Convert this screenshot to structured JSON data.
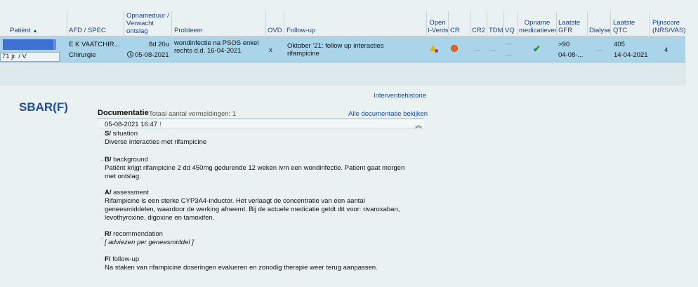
{
  "table": {
    "headers": {
      "patient": "Patiënt",
      "afd": "AFD / SPEC",
      "opname": [
        "Opnameduur /",
        "Verwacht",
        "ontslag"
      ],
      "probleem": "Probleem",
      "ovd": "OVD",
      "followup": "Follow-up",
      "open": [
        "Open",
        "I-Vents"
      ],
      "cr": "CR",
      "cr2": "CR2",
      "tdm": "TDM",
      "vq": "VQ",
      "opname_med": [
        "Opname",
        "medicatiever"
      ],
      "gfr": [
        "Laatste",
        "GFR"
      ],
      "dialyse": "Dialyse",
      "qtc": [
        "Laatste",
        "QTC"
      ],
      "pijn": [
        "Pijnscore",
        "(NRS/VAS)"
      ]
    },
    "row": {
      "age": "71 jr. / V",
      "afd": "E K VAATCHIR...",
      "spec": "Chirurgie",
      "duur": "8d 20u",
      "datum": "05-08-2021",
      "probleem": [
        "wondinfectie na PSOS enkel",
        "rechts d.d. 16-04-2021"
      ],
      "ovd": "x",
      "followup": [
        "Oktober '21: follow up interacties",
        "rifampicine"
      ],
      "dash": "—",
      "gfr": ">90",
      "gfr_date": "04-08-...",
      "qtc": "405",
      "qtc_date": "14-04-2021",
      "pijn": "4"
    }
  },
  "sbar": {
    "title": "SBAR(F)",
    "historie_link": "Interventiehistorie",
    "doc_title": "Documentatie",
    "doc_count": "Totaal aantal vermeldingen: 1",
    "alle_link": "Alle documentatie bekijken",
    "entry_date": "05-08-2021 16:47",
    "entry_flag": "!",
    "sections": {
      "s": {
        "key": "S/",
        "label": "situation",
        "text": "Diverse interacties met rifampicine"
      },
      "b": {
        "key": "B/",
        "label": "background",
        "text": "Patiënt krijgt rifampicine 2 dd 450mg gedurende 12 weken ivm een wondinfectie. Patient gaat morgen met ontslag."
      },
      "a": {
        "key": "A/",
        "label": "assessment",
        "text": "Rifampicine is een sterke CYP3A4-inductor. Het verlaagt de concentratie van een aantal geneesmiddelen, waardoor de werking afneemt. Bij de actuele medicatie geldt dit voor: rivaroxaban, levothyroxine, digoxine en tamoxifen."
      },
      "r": {
        "key": "R/",
        "label": "recommendation",
        "text": "[ adviezen per geneesmiddel ]"
      },
      "f": {
        "key": "F/",
        "label": "follow-up",
        "text": "Na staken van rifampicine doseringen evalueren en zonodig therapie weer terug aanpassen."
      }
    }
  },
  "colors": {
    "row_selected": "#a9d4ea",
    "link": "#1a4aa2",
    "title": "#1f4ea0",
    "redaction": "#3f6fd0"
  }
}
